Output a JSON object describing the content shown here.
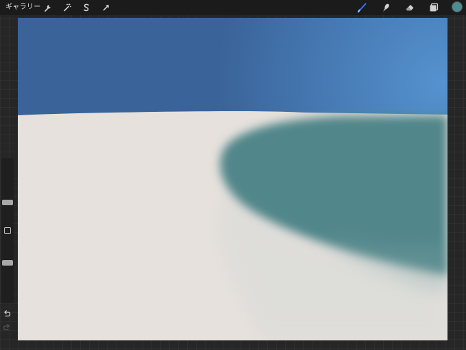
{
  "toolbar": {
    "gallery_label": "ギャラリー",
    "left_tools": [
      {
        "name": "actions",
        "icon": "wrench-icon"
      },
      {
        "name": "adjustments",
        "icon": "magic-wand-icon"
      },
      {
        "name": "selection",
        "icon": "selection-s-icon"
      },
      {
        "name": "transform",
        "icon": "arrow-cursor-icon"
      }
    ],
    "right_tools": [
      {
        "name": "brush",
        "icon": "brush-icon",
        "active": true
      },
      {
        "name": "smudge",
        "icon": "smudge-finger-icon",
        "active": false
      },
      {
        "name": "eraser",
        "icon": "eraser-icon",
        "active": false
      },
      {
        "name": "layers",
        "icon": "layers-icon",
        "active": false
      }
    ],
    "current_color": "#4d8c90",
    "active_tool_color": "#2f7cf6"
  },
  "sidebar": {
    "brush_size_level": 0.3,
    "opacity_level": 0.6,
    "modify_button_icon": "square-icon",
    "undo_icon": "undo-arrow-icon",
    "redo_icon": "redo-arrow-icon"
  },
  "canvas": {
    "sky_color": "#3a6399",
    "sky_highlight_color": "#5592cf",
    "sand_color": "#e6e1dc",
    "water_color": "#51868a"
  }
}
